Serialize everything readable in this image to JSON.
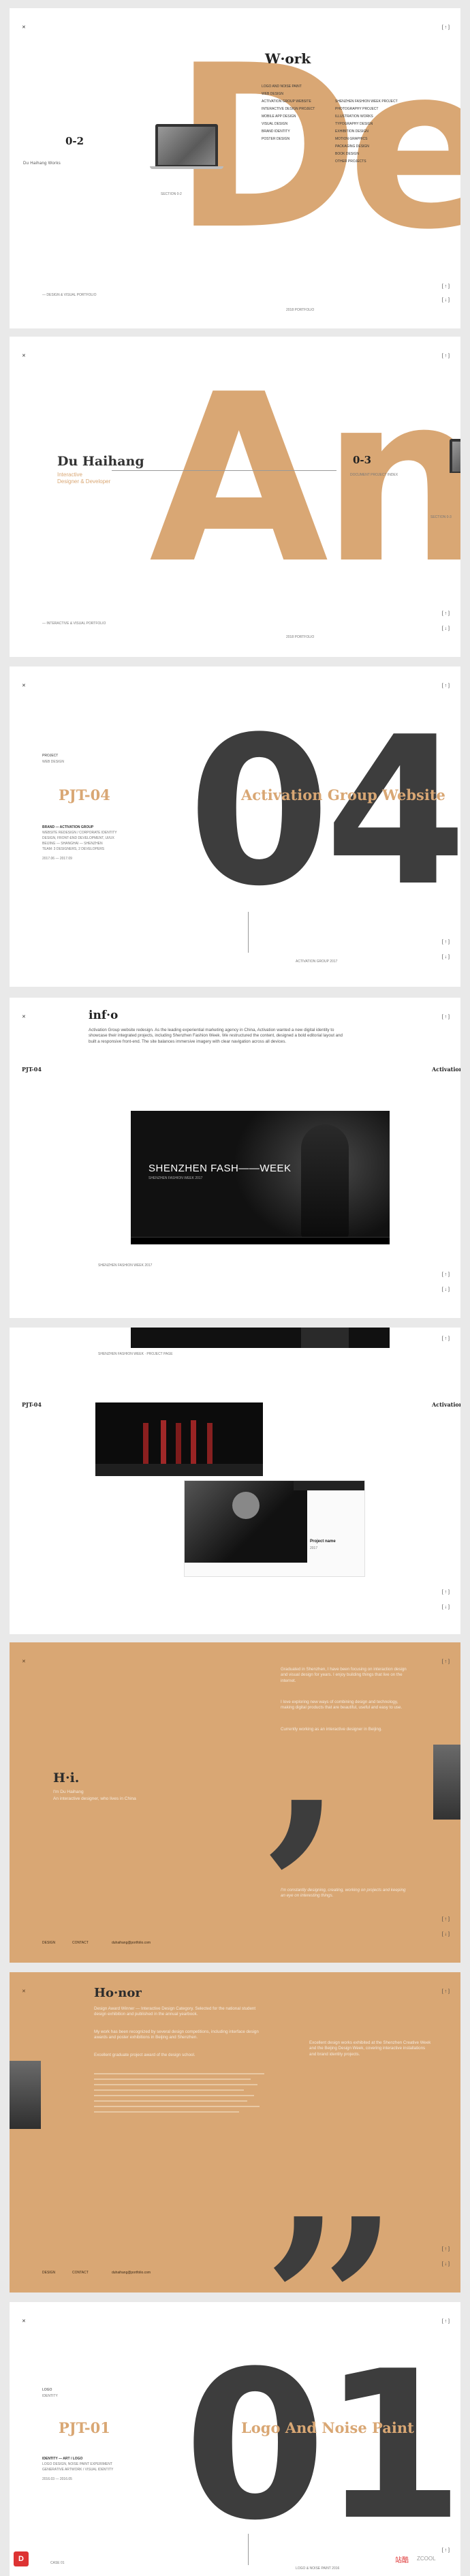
{
  "common": {
    "menu_glyph": "✕",
    "nav_arrows": "[ ↑ ]",
    "nav_down": "[ ↓ ]",
    "colors": {
      "accent": "#d9a774",
      "dark_number": "#3d3d3d",
      "page_bg": "#e9e9e9"
    }
  },
  "slide1": {
    "section": "0-2",
    "subtitle": "Du Haihang Works",
    "big_text": "De",
    "title": "W·ork",
    "left_list": [
      "LOGO AND NOISE PAINT",
      "WEB DESIGN",
      "ACTIVATION GROUP WEBSITE",
      "INTERACTIVE DESIGN PROJECT",
      "MOBILE APP DESIGN",
      "VISUAL DESIGN",
      "BRAND IDENTITY",
      "POSTER DESIGN"
    ],
    "right_list": [
      "SHENZHEN FASHION WEEK PROJECT",
      "PHOTOGRAPHY PROJECT",
      "ILLUSTRATION WORKS",
      "TYPOGRAPHY DESIGN",
      "EXHIBITION DESIGN",
      "MOTION GRAPHICS",
      "PACKAGING DESIGN",
      "BOOK DESIGN",
      "OTHER PROJECTS"
    ],
    "laptop_caption": "SECTION 0-2",
    "footer": "— DESIGN & VISUAL PORTFOLIO",
    "footer_right": "2018 PORTFOLIO"
  },
  "slide2": {
    "big_text": "An",
    "name": "Du Haihang",
    "role1": "Interactive",
    "role2": "Designer & Developer",
    "section": "0-3",
    "section_sub": "DOCUMENT PROJECT INDEX",
    "laptop_caption": "SECTION 0-3",
    "footer": "— INTERACTIVE & VISUAL PORTFOLIO",
    "footer_right": "2018 PORTFOLIO"
  },
  "slide3": {
    "small1": "PROJECT",
    "small2": "WEB DESIGN",
    "code": "PJT-04",
    "big_text": "04",
    "title": "Activation Group Website",
    "meta_lines": [
      "BRAND — ACTIVATION GROUP",
      "WEBSITE REDESIGN / CORPORATE IDENTITY",
      "DESIGN, FRONT-END DEVELOPMENT, UI/UX",
      "BEIJING — SHANGHAI — SHENZHEN",
      "TEAM: 3 DESIGNERS, 2 DEVELOPERS",
      "2017.06 — 2017.09"
    ],
    "caption": "ACTIVATION GROUP 2017"
  },
  "slide4": {
    "code": "PJT-04",
    "heading": "inf·o",
    "right_label": "Activation",
    "body": "Activation Group website redesign. As the leading experiential marketing agency in China, Activation wanted a new digital identity to showcase their integrated projects, including Shenzhen Fashion Week. We restructured the content, designed a bold editorial layout and built a responsive front-end. The site balances immersive imagery with clear navigation across all devices.",
    "hero_text": "SHENZHEN FASH——WEEK",
    "hero_small": "SHENZHEN FASHION WEEK 2017"
  },
  "slide5": {
    "code": "PJT-04",
    "right_label": "Activation",
    "caption_top": "SHENZHEN FASHION WEEK · PROJECT PAGE",
    "project_title": "Project name",
    "project_meta": "2017"
  },
  "slide6": {
    "heading": "H·i.",
    "sub1": "I'm Du Haihang",
    "sub2": "An interactive designer, who lives in China",
    "para1": "Graduated in Shenzhen, I have been focusing on interaction design and visual design for years. I enjoy building things that live on the internet.",
    "para2": "I love exploring new ways of combining design and technology, making digital products that are beautiful, useful and easy to use.",
    "para3": "Currently working as an interactive designer in Beijing.",
    "quote": "I'm constantly designing, creating, working on projects and keeping an eye on interesting things.",
    "footer1": "DESIGN",
    "footer2": "CONTACT",
    "footer3": "duhaihang@portfolio.com"
  },
  "slide7": {
    "heading": "Ho·nor",
    "para1": "Design Award Winner — Interactive Design Category. Selected for the national student design exhibition and published in the annual yearbook.",
    "para2": "My work has been recognized by several design competitions, including interface design awards and poster exhibitions in Beijing and Shenzhen.",
    "para3": "Excellent graduate project award of the design school.",
    "right_para": "Excellent design works exhibited at the Shenzhen Creative Week and the Beijing Design Week, covering interactive installations and brand identity projects.",
    "footer1": "DESIGN",
    "footer2": "CONTACT",
    "footer3": "duhaihang@portfolio.com"
  },
  "slide8": {
    "small1": "LOGO",
    "small2": "IDENTITY",
    "code": "PJT-01",
    "big_text": "01",
    "title": "Logo And Noise Paint",
    "meta_lines": [
      "IDENTITY — ART / LOGO",
      "LOGO DESIGN, NOISE PAINT EXPERIMENT",
      "GENERATIVE ARTWORK / VISUAL IDENTITY",
      "2016.03 — 2016.05"
    ],
    "caption": "LOGO & NOISE PAINT 2016",
    "footer": "CASE 01"
  },
  "watermark": {
    "text": "站酷",
    "sub": "ZCOOL"
  }
}
